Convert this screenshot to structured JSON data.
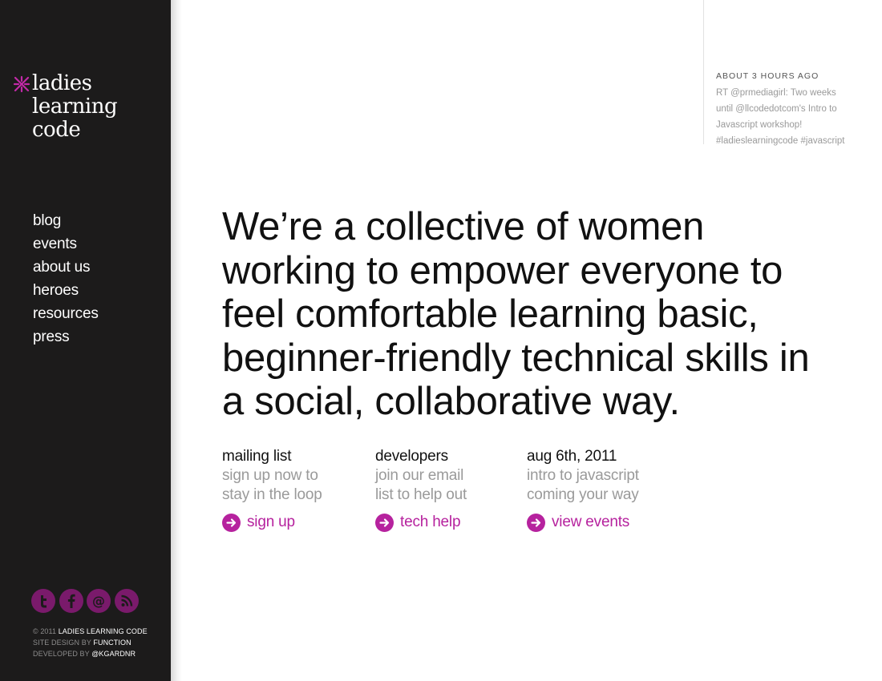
{
  "sidebar": {
    "logo": {
      "lines": [
        "ladies",
        "learning",
        "code"
      ],
      "icon": "asterisk-x-mark"
    },
    "nav": [
      "blog",
      "events",
      "about us",
      "heroes",
      "resources",
      "press"
    ],
    "social": [
      {
        "name": "twitter",
        "icon": "twitter-icon"
      },
      {
        "name": "facebook",
        "icon": "facebook-icon"
      },
      {
        "name": "email",
        "icon": "at-icon"
      },
      {
        "name": "rss",
        "icon": "rss-icon"
      }
    ],
    "credits": {
      "line1_prefix": "© 2011",
      "line1_hl": "LADIES LEARNING CODE",
      "line2_prefix": "SITE DESIGN BY",
      "line2_hl": "FUNCTION",
      "line3_prefix": "DEVELOPED BY",
      "line3_hl": "@KGARDNR"
    }
  },
  "tweet": {
    "time": "ABOUT 3 HOURS AGO",
    "lines": [
      "RT @prmediagirl: Two weeks",
      "until @llcodedotcom's Intro to",
      "Javascript workshop!",
      "#ladieslearningcode #javascript"
    ]
  },
  "headline": {
    "lines": [
      "We’re a collective of women",
      "working to empower everyone to",
      "feel comfortable learning basic,",
      "beginner-friendly technical skills in",
      "a social, collaborative way."
    ]
  },
  "columns": [
    {
      "title": "mailing list",
      "desc": [
        "sign up now to",
        "stay in the loop"
      ],
      "link": "sign up"
    },
    {
      "title": "developers",
      "desc": [
        "join our email",
        "list to help out"
      ],
      "link": "tech help"
    },
    {
      "title": "aug 6th, 2011",
      "desc": [
        "intro to javascript",
        "coming your way"
      ],
      "link": "view events"
    }
  ],
  "colors": {
    "sidebar_bg": "#1c1b1b",
    "accent": "#b6229e",
    "social_icon_bg": "#7a1a6b",
    "headline": "#111111",
    "muted": "#9a9a9a"
  }
}
